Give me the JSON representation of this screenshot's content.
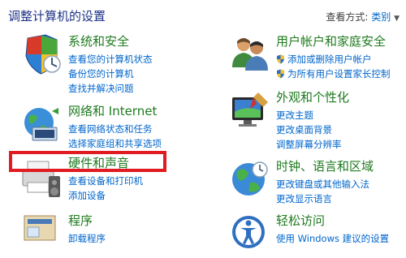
{
  "header": {
    "title": "调整计算机的设置",
    "view_by_label": "查看方式:",
    "view_by_value": "类别"
  },
  "categories": {
    "system_security": {
      "title": "系统和安全",
      "links": [
        "查看您的计算机状态",
        "备份您的计算机",
        "查找并解决问题"
      ]
    },
    "user_accounts": {
      "title": "用户帐户和家庭安全",
      "links": [
        "添加或删除用户帐户",
        "为所有用户设置家长控制"
      ]
    },
    "network_internet": {
      "title": "网络和 Internet",
      "links": [
        "查看网络状态和任务",
        "选择家庭组和共享选项"
      ]
    },
    "appearance": {
      "title": "外观和个性化",
      "links": [
        "更改主题",
        "更改桌面背景",
        "调整屏幕分辨率"
      ]
    },
    "hardware_sound": {
      "title": "硬件和声音",
      "links": [
        "查看设备和打印机",
        "添加设备"
      ]
    },
    "clock_language": {
      "title": "时钟、语言和区域",
      "links": [
        "更改键盘或其他输入法",
        "更改显示语言"
      ]
    },
    "programs": {
      "title": "程序",
      "links": [
        "卸载程序"
      ]
    },
    "ease_of_access": {
      "title": "轻松访问",
      "links": [
        "使用 Windows 建议的设置"
      ]
    }
  },
  "icons": {
    "system_security": "shield-icon",
    "user_accounts": "users-icon",
    "network_internet": "network-globe-icon",
    "appearance": "monitor-paint-icon",
    "hardware_sound": "printer-speaker-icon",
    "clock_language": "globe-clock-icon",
    "programs": "programs-box-icon",
    "ease_of_access": "ease-access-icon"
  },
  "colors": {
    "title": "#1e3287",
    "category_title": "#1e7a1e",
    "link": "#0066cc",
    "highlight": "#e01b22"
  }
}
